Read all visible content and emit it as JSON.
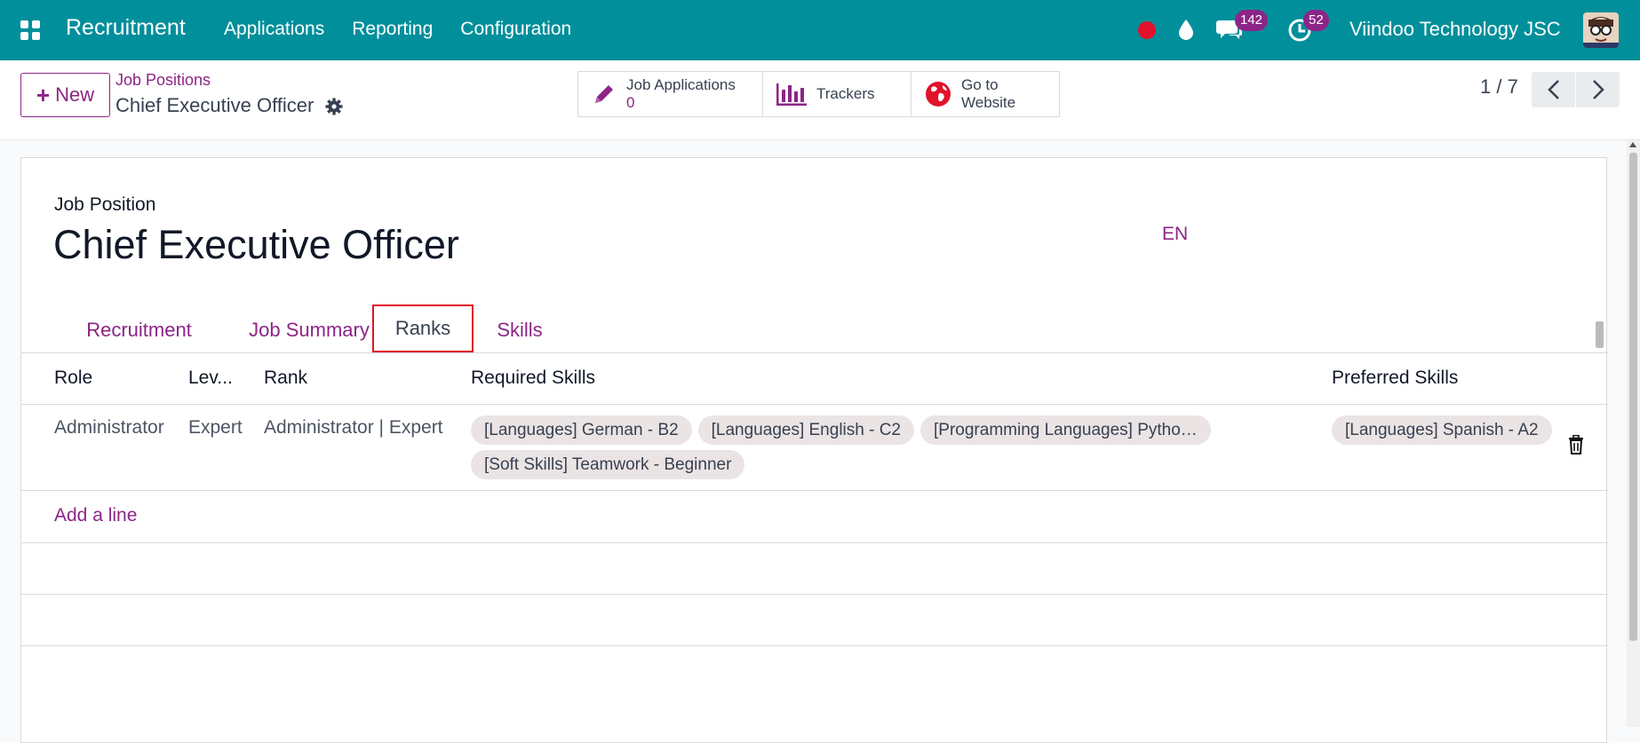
{
  "navbar": {
    "app_title": "Recruitment",
    "menu": [
      "Applications",
      "Reporting",
      "Configuration"
    ],
    "message_count": "142",
    "activity_count": "52",
    "company": "Viindoo Technology JSC"
  },
  "control": {
    "new_label": "New",
    "breadcrumb": "Job Positions",
    "record_name": "Chief Executive Officer",
    "smart_buttons": {
      "applications_label": "Job Applications",
      "applications_count": "0",
      "trackers_label": "Trackers",
      "website_line1": "Go to",
      "website_line2": "Website"
    },
    "pager": "1 / 7"
  },
  "form": {
    "field_label": "Job Position",
    "title": "Chief Executive Officer",
    "language": "EN",
    "tabs": [
      "Recruitment",
      "Job Summary",
      "Ranks",
      "Skills"
    ],
    "active_tab": "Ranks",
    "columns": [
      "Role",
      "Lev...",
      "Rank",
      "Required Skills",
      "Preferred Skills"
    ],
    "rows": [
      {
        "role": "Administrator",
        "level": "Expert",
        "rank": "Administrator | Expert",
        "required_skills": [
          "[Languages] German - B2",
          "[Languages] English - C2",
          "[Programming Languages] Pytho…",
          "[Soft Skills] Teamwork - Beginner"
        ],
        "preferred_skills": [
          "[Languages] Spanish - A2"
        ]
      }
    ],
    "add_line": "Add a line"
  },
  "colors": {
    "navbar": "#018f9b",
    "accent": "#8c2587",
    "highlight": "#e1122a"
  }
}
